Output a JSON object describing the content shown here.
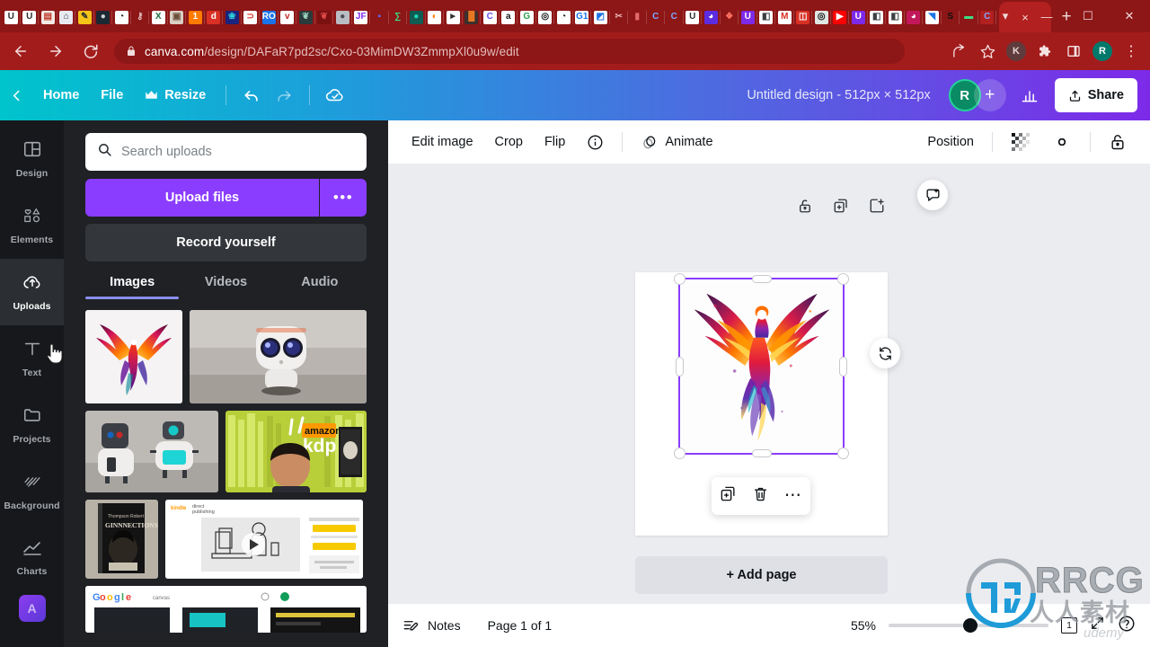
{
  "browser": {
    "tabs": [
      {
        "name": "tab-udemy-1",
        "label": "U",
        "bg": "#ffffff",
        "fg": "#2d2f31"
      },
      {
        "name": "tab-udemy-2",
        "label": "U",
        "bg": "#ffffff",
        "fg": "#2d2f31"
      },
      {
        "name": "tab-news",
        "label": "▤",
        "bg": "#f2e9e4",
        "fg": "#c0392b"
      },
      {
        "name": "tab-graduate",
        "label": "⌂",
        "bg": "#e8eaf0",
        "fg": "#2c3e50"
      },
      {
        "name": "tab-yellow-book",
        "label": "✎",
        "bg": "#f5c518",
        "fg": "#2d2f31"
      },
      {
        "name": "tab-face",
        "label": "●",
        "bg": "#1c2833",
        "fg": "#cdd3d8"
      },
      {
        "name": "tab-globe",
        "label": "◔",
        "bg": "#ffffff",
        "fg": "#111111"
      },
      {
        "name": "tab-key",
        "label": "⚷",
        "bg": "#8d1616",
        "fg": "#e5c8c8"
      },
      {
        "name": "tab-excel",
        "label": "X",
        "bg": "#ffffff",
        "fg": "#1d6f42"
      },
      {
        "name": "tab-bag",
        "label": "▣",
        "bg": "#d9cfc4",
        "fg": "#6b4f3a"
      },
      {
        "name": "tab-one",
        "label": "1",
        "bg": "#ff7a00",
        "fg": "#ffffff"
      },
      {
        "name": "tab-d-red",
        "label": "d",
        "bg": "#d93025",
        "fg": "#ffffff"
      },
      {
        "name": "tab-ribbon",
        "label": "❀",
        "bg": "#1a237e",
        "fg": "#2fd6e0"
      },
      {
        "name": "tab-magnet",
        "label": "⊃",
        "bg": "#ffffff",
        "fg": "#d93025"
      },
      {
        "name": "tab-ro",
        "label": "RO",
        "bg": "#1a73e8",
        "fg": "#ffffff"
      },
      {
        "name": "tab-v-red",
        "label": "v",
        "bg": "#ffffff",
        "fg": "#c62828"
      },
      {
        "name": "tab-leaf",
        "label": "❦",
        "bg": "#2b3a3a",
        "fg": "#9ad3c0"
      },
      {
        "name": "tab-rooster",
        "label": "❦",
        "bg": "#7b1010",
        "fg": "#e04b4b"
      },
      {
        "name": "tab-ghost",
        "label": "●",
        "bg": "#b9bcc2",
        "fg": "#4a4d52"
      },
      {
        "name": "tab-jf",
        "label": "JF",
        "bg": "#ffffff",
        "fg": "#7d2ae8"
      },
      {
        "name": "tab-blue-dot",
        "label": "▪",
        "bg": "#8d1616",
        "fg": "#5b6ef5"
      },
      {
        "name": "tab-sigma",
        "label": "∑",
        "bg": "#8d1616",
        "fg": "#3ddc84"
      },
      {
        "name": "tab-teal-circle",
        "label": "●",
        "bg": "#0f5c52",
        "fg": "#1ed6b5"
      },
      {
        "name": "tab-orange-circle",
        "label": "◐",
        "bg": "#ffffff",
        "fg": "#f57c00"
      },
      {
        "name": "tab-eagle",
        "label": "►",
        "bg": "#ffffff",
        "fg": "#2d2f31"
      },
      {
        "name": "tab-chart",
        "label": "█",
        "bg": "#3b2f2f",
        "fg": "#e87722"
      },
      {
        "name": "tab-c-purple",
        "label": "C",
        "bg": "#ffffff",
        "fg": "#6a4df5"
      },
      {
        "name": "tab-amazon",
        "label": "a",
        "bg": "#ffffff",
        "fg": "#1c1c1c"
      },
      {
        "name": "tab-g-green",
        "label": "G",
        "bg": "#ffffff",
        "fg": "#2e9e4f"
      },
      {
        "name": "tab-openai",
        "label": "◎",
        "bg": "#ffffff",
        "fg": "#0f0f0f"
      },
      {
        "name": "tab-globe-2",
        "label": "◔",
        "bg": "#ffffff",
        "fg": "#111111"
      },
      {
        "name": "tab-g1",
        "label": "G1",
        "bg": "#ffffff",
        "fg": "#1a73e8"
      },
      {
        "name": "tab-blue-doc",
        "label": "◩",
        "bg": "#ffffff",
        "fg": "#1a73e8"
      },
      {
        "name": "tab-scissors",
        "label": "✂",
        "bg": "#8d1616",
        "fg": "#e8b0b0"
      },
      {
        "name": "tab-red-block",
        "label": "▮",
        "bg": "#8d1616",
        "fg": "#e56b6b"
      },
      {
        "name": "tab-c-1",
        "label": "C",
        "bg": "#8d1616",
        "fg": "#7fa9ff"
      },
      {
        "name": "tab-c-2",
        "label": "C",
        "bg": "#8d1616",
        "fg": "#7fa9ff"
      },
      {
        "name": "tab-udemy-3",
        "label": "U",
        "bg": "#ffffff",
        "fg": "#2d2f31"
      },
      {
        "name": "tab-c-circle",
        "label": "◕",
        "bg": "#5b2ce0",
        "fg": "#ffffff"
      },
      {
        "name": "tab-figma",
        "label": "❖",
        "bg": "#8d1616",
        "fg": "#ff7262"
      },
      {
        "name": "tab-udemy-4",
        "label": "U",
        "bg": "#7d2ae8",
        "fg": "#ffffff"
      },
      {
        "name": "tab-doc-white",
        "label": "◧",
        "bg": "#ffffff",
        "fg": "#3c4043"
      },
      {
        "name": "tab-gmail",
        "label": "M",
        "bg": "#ffffff",
        "fg": "#d93025"
      },
      {
        "name": "tab-book-red",
        "label": "◫",
        "bg": "#d93025",
        "fg": "#ffffff"
      },
      {
        "name": "tab-openai-2",
        "label": "◎",
        "bg": "#dfe7e3",
        "fg": "#0f0f0f"
      },
      {
        "name": "tab-youtube",
        "label": "▶",
        "bg": "#ff0000",
        "fg": "#ffffff"
      },
      {
        "name": "tab-udemy-5",
        "label": "U",
        "bg": "#7d2ae8",
        "fg": "#ffffff"
      },
      {
        "name": "tab-doc-white-2",
        "label": "◧",
        "bg": "#ffffff",
        "fg": "#3c4043"
      },
      {
        "name": "tab-doc-white-3",
        "label": "◧",
        "bg": "#ffffff",
        "fg": "#3c4043"
      },
      {
        "name": "tab-c-pink",
        "label": "◕",
        "bg": "#c2185b",
        "fg": "#ffffff"
      },
      {
        "name": "tab-sail",
        "label": "◥",
        "bg": "#ffffff",
        "fg": "#1a73e8"
      },
      {
        "name": "tab-s-dark",
        "label": "S",
        "bg": "#8d1616",
        "fg": "#0f0f0f"
      },
      {
        "name": "tab-green-bar",
        "label": "▬",
        "bg": "#8d1616",
        "fg": "#3ddc84"
      },
      {
        "name": "tab-canva-active",
        "label": "C",
        "bg": "#b22020",
        "fg": "#7fa9ff"
      }
    ],
    "close_tab_label": "×",
    "new_tab_label": "+",
    "window_controls": [
      "⌄",
      "—",
      "❐",
      "✕"
    ],
    "nav": {
      "back": "←",
      "forward": "→",
      "reload": "⟳",
      "url_domain": "canva.com",
      "url_path": "/design/DAFaR7pd2sc/Cxo-03MimDW3ZmmpXl0u9w/edit"
    },
    "toolbar_right": {
      "share_icon": "share-icon",
      "bookmark_icon": "star-icon",
      "profile_k": "K",
      "extensions_icon": "puzzle-icon",
      "sidepanel_icon": "sidepanel-icon",
      "profile_r": "R",
      "menu_icon": "⋮"
    }
  },
  "canva_header": {
    "back_chevron": "‹",
    "home": "Home",
    "file": "File",
    "resize": "Resize",
    "resize_crown": "crown-icon",
    "undo": "undo-icon",
    "redo": "redo-icon",
    "cloud_saved": "cloud-check-icon",
    "doc_title": "Untitled design - 512px × 512px",
    "avatar_initial": "R",
    "add_collaborator": "+",
    "insights_icon": "insights-icon",
    "share_label": "Share"
  },
  "rail": {
    "items": [
      {
        "name": "sidebar-item-design",
        "label": "Design",
        "icon": "layout-icon",
        "active": false
      },
      {
        "name": "sidebar-item-elements",
        "label": "Elements",
        "icon": "shapes-icon",
        "active": false
      },
      {
        "name": "sidebar-item-uploads",
        "label": "Uploads",
        "icon": "upload-cloud-icon",
        "active": true
      },
      {
        "name": "sidebar-item-text",
        "label": "Text",
        "icon": "text-t-icon",
        "active": false
      },
      {
        "name": "sidebar-item-projects",
        "label": "Projects",
        "icon": "folder-icon",
        "active": false
      },
      {
        "name": "sidebar-item-background",
        "label": "Background",
        "icon": "hatch-icon",
        "active": false
      },
      {
        "name": "sidebar-item-charts",
        "label": "Charts",
        "icon": "line-chart-icon",
        "active": false
      }
    ],
    "app_tile": "A"
  },
  "panel": {
    "search_placeholder": "Search uploads",
    "search_value": "",
    "upload_files_label": "Upload files",
    "upload_more_label": "•••",
    "record_label": "Record yourself",
    "tabs": [
      {
        "name": "tab-images",
        "label": "Images",
        "active": true
      },
      {
        "name": "tab-videos",
        "label": "Videos",
        "active": false
      },
      {
        "name": "tab-audio",
        "label": "Audio",
        "active": false
      }
    ],
    "thumbnails": [
      {
        "name": "upload-thumb-phoenix",
        "kind": "phoenix"
      },
      {
        "name": "upload-thumb-white-robot",
        "kind": "white-robot"
      },
      {
        "name": "upload-thumb-two-robots",
        "kind": "two-robots"
      },
      {
        "name": "upload-thumb-kdp-thumbnail",
        "kind": "kdp",
        "text": "kdp",
        "brand": "amazon"
      },
      {
        "name": "upload-thumb-book-cover",
        "kind": "book",
        "text": "GINNNECTIONS"
      },
      {
        "name": "upload-thumb-kdp-page",
        "kind": "kdp-page",
        "text": "direct publishing",
        "brand": "kindle"
      },
      {
        "name": "upload-thumb-google-search",
        "kind": "google",
        "text": "Google"
      }
    ]
  },
  "context_toolbar": {
    "edit_image": "Edit image",
    "crop": "Crop",
    "flip": "Flip",
    "info_icon": "info-icon",
    "animate_icon": "animate-icon",
    "animate": "Animate",
    "position": "Position",
    "transparency_icon": "transparency-icon",
    "link_icon": "link-icon",
    "lock_icon": "lock-icon"
  },
  "canvas": {
    "page_tools": [
      {
        "name": "page-lock-button",
        "icon": "lock-open-icon"
      },
      {
        "name": "page-duplicate-button",
        "icon": "duplicate-page-icon"
      },
      {
        "name": "page-add-button",
        "icon": "add-page-icon"
      }
    ],
    "selection": {
      "color": "#8b3dff",
      "element": "phoenix-image"
    },
    "element_toolbar": [
      {
        "name": "duplicate-element-button",
        "icon": "duplicate-icon"
      },
      {
        "name": "delete-element-button",
        "icon": "trash-icon"
      },
      {
        "name": "more-options-button",
        "icon": "ellipsis-icon"
      }
    ],
    "comment_button": "comment-add-icon",
    "rotate_button": "rotate-icon",
    "add_page_label": "+ Add page",
    "scroll_up_icon": "⌃"
  },
  "status_bar": {
    "notes_icon": "notes-icon",
    "notes_label": "Notes",
    "page_indicator": "Page 1 of 1",
    "zoom_level": "55%",
    "zoom_value": 55,
    "page_count_chip": "1",
    "fullscreen_icon": "fullscreen-icon",
    "help_icon": "?"
  },
  "watermark": {
    "text": "RRCG",
    "subtitle": "人人素材",
    "source": "udemy"
  },
  "colors": {
    "browser_chrome": "#a31c1c",
    "canva_purple": "#8b3dff",
    "panel_bg": "#1f2125",
    "rail_bg": "#16181c",
    "editor_bg": "#ebecf0"
  }
}
